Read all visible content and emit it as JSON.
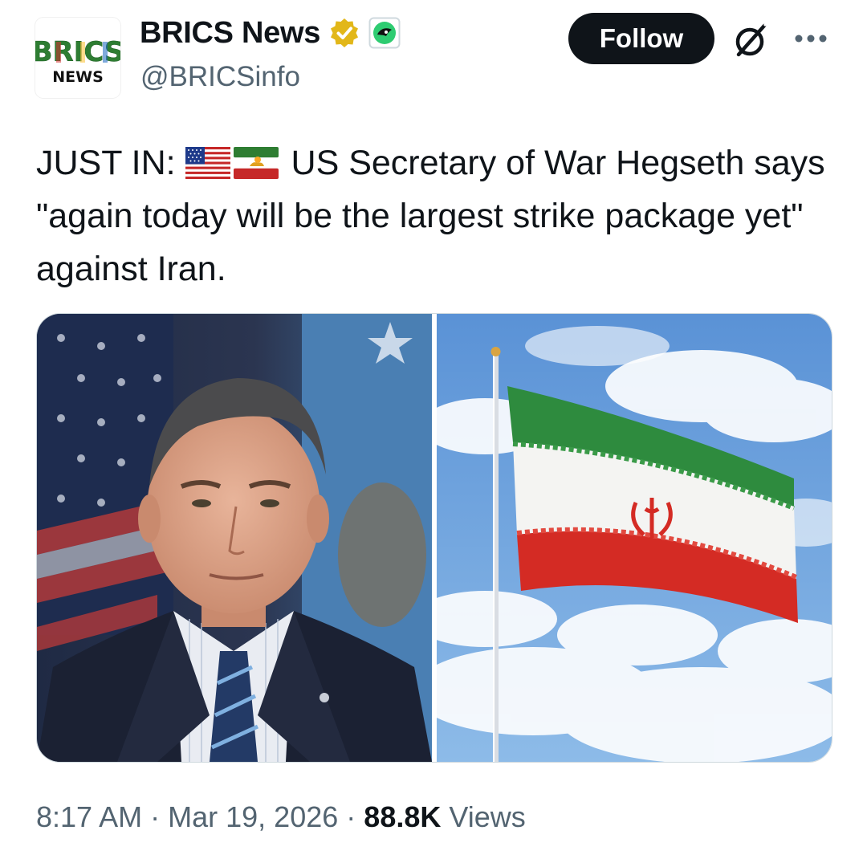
{
  "account": {
    "avatar_line1": "BRICS",
    "avatar_line2": "NEWS",
    "display_name": "BRICS News",
    "handle": "@BRICSinfo",
    "verified_badge": "gold-verified-badge-icon",
    "affiliate_badge": "affiliate-badge-icon"
  },
  "actions": {
    "follow_label": "Follow",
    "grok_icon": "grok-icon",
    "more_icon": "more-options-icon"
  },
  "tweet": {
    "prefix": "JUST IN:",
    "flags": [
      "us-flag-emoji",
      "iran-lion-and-sun-flag-emoji"
    ],
    "body": "US Secretary of War Hegseth says \"again today will be the largest strike package yet\" against Iran."
  },
  "media": [
    {
      "alt": "Portrait photo of Hegseth in suit in front of flags"
    },
    {
      "alt": "Iranian flag on flagpole against blue sky with clouds"
    }
  ],
  "meta": {
    "time": "8:17 AM",
    "date": "Mar 19, 2026",
    "separator": "·",
    "views_count": "88.8K",
    "views_label": "Views"
  },
  "colors": {
    "text_primary": "#0f1419",
    "text_secondary": "#536471",
    "follow_bg": "#0f1419",
    "verified_gold": "#e2b719"
  }
}
